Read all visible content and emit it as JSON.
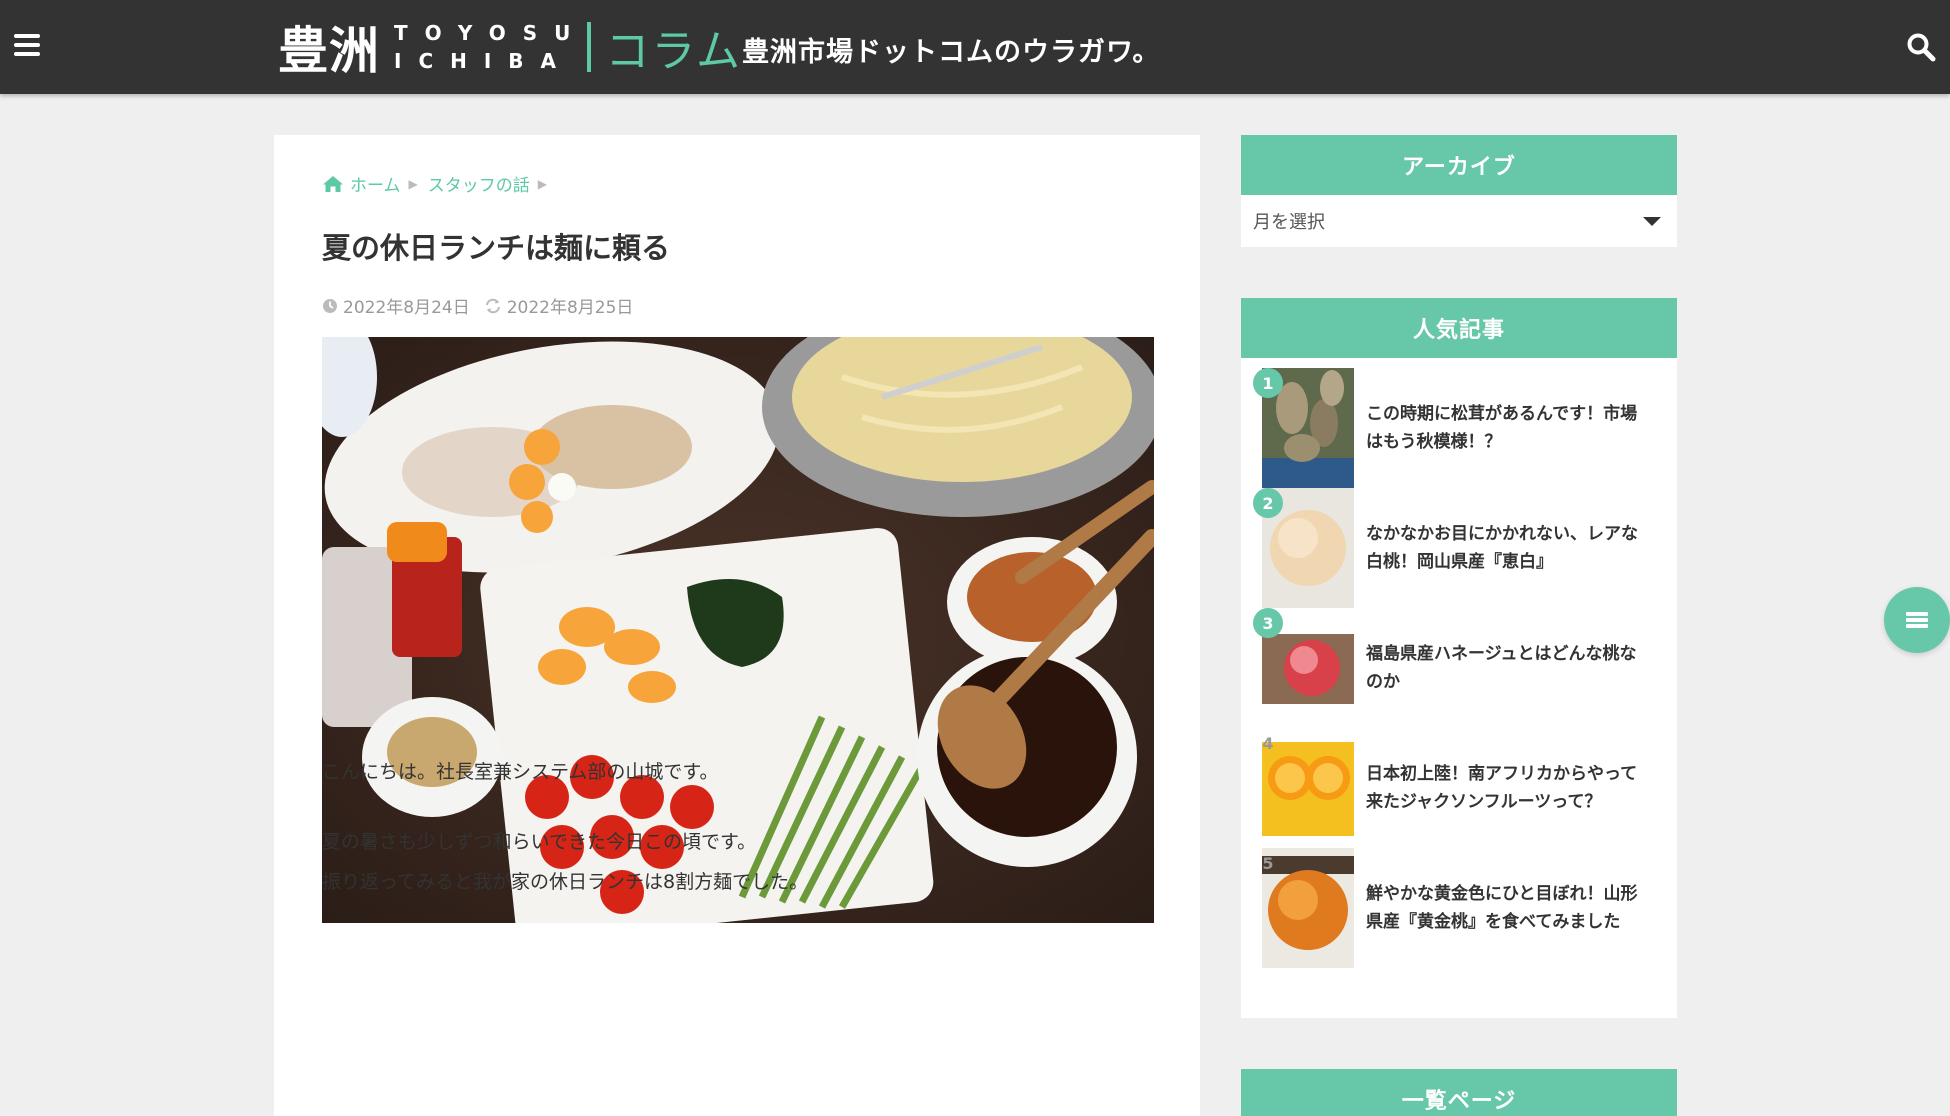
{
  "header": {
    "logo_kanji": "豊洲",
    "logo_en_top": "TOYOSU",
    "logo_en_bottom": "ICHIBA",
    "logo_column": "コラム",
    "tagline": "豊洲市場ドットコムのウラガワ。",
    "icons": {
      "menu": "hamburger-menu-icon",
      "search": "search-icon"
    }
  },
  "breadcrumb": {
    "home_label": "ホーム",
    "category_label": "スタッフの話",
    "home_icon": "home-icon"
  },
  "post": {
    "title": "夏の休日ランチは麺に頼る",
    "published": "2022年8月24日",
    "updated": "2022年8月25日",
    "hero_alt": "冷やし中華の具材と麺、たれ",
    "paragraphs": [
      "こんにちは。社長室兼システム部の山城です。",
      "夏の暑さも少しずつ和らいできた今日この頃です。",
      "振り返ってみると我が家の休日ランチは8割方麺でした。"
    ]
  },
  "sidebar": {
    "archive": {
      "title": "アーカイブ",
      "select_label": "月を選択"
    },
    "popular": {
      "title": "人気記事",
      "items": [
        {
          "rank": "1",
          "title_line1": "この時期に松茸があるんです！市場",
          "title_line2": "はもう秋模様！？"
        },
        {
          "rank": "2",
          "title_line1": "なかなかお目にかかれない、レアな",
          "title_line2": "白桃！岡山県産『恵白』"
        },
        {
          "rank": "3",
          "title_line1": "福島県産ハネージュとはどんな桃な",
          "title_line2": "のか"
        },
        {
          "rank": "4",
          "title_line1": "日本初上陸！南アフリカからやって",
          "title_line2": "来たジャクソンフルーツって？"
        },
        {
          "rank": "5",
          "title_line1": "鮮やかな黄金色にひと目ぼれ！山形",
          "title_line2": "県産『黄金桃』を食べてみました"
        }
      ]
    },
    "list_page": {
      "title": "一覧ページ"
    }
  },
  "colors": {
    "accent": "#67c8a9",
    "header_bg": "#333333",
    "page_bg": "#efefef"
  }
}
